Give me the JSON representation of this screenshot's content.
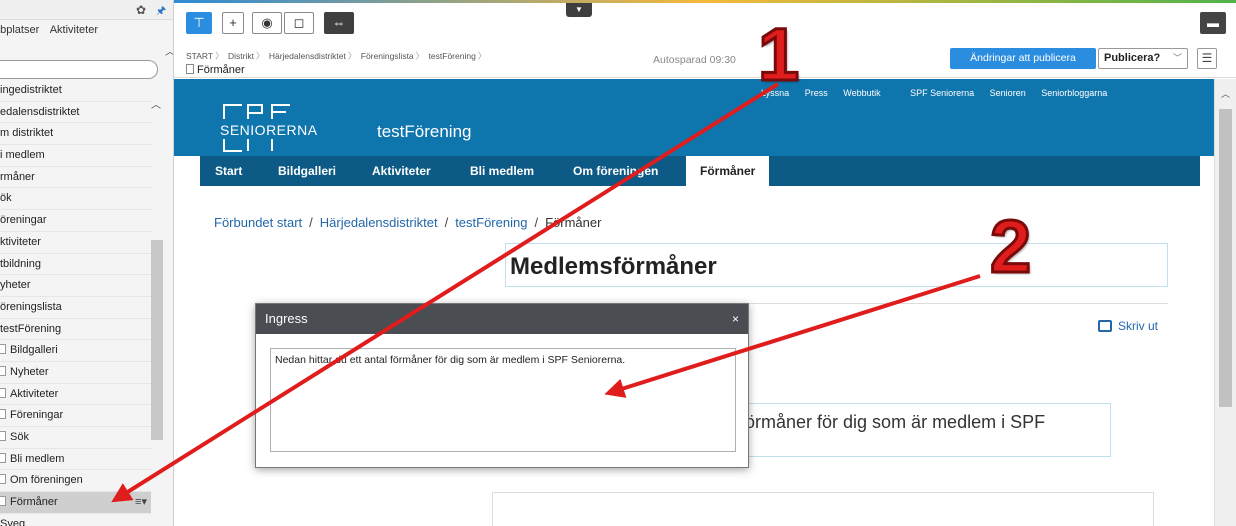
{
  "left_panel": {
    "tabs": [
      "obplatser",
      "Aktiviteter"
    ],
    "tree": [
      {
        "label": "ingedistriktet",
        "doc": false
      },
      {
        "label": "edalensdistriktet",
        "doc": false
      },
      {
        "label": "m distriktet",
        "doc": false
      },
      {
        "label": "i medlem",
        "doc": false
      },
      {
        "label": "rmåner",
        "doc": false
      },
      {
        "label": "ök",
        "doc": false
      },
      {
        "label": "öreningar",
        "doc": false
      },
      {
        "label": "ktiviteter",
        "doc": false
      },
      {
        "label": "tbildning",
        "doc": false
      },
      {
        "label": "yheter",
        "doc": false
      },
      {
        "label": "öreningslista",
        "doc": false
      },
      {
        "label": "testFörening",
        "doc": false
      },
      {
        "label": "Bildgalleri",
        "doc": true
      },
      {
        "label": "Nyheter",
        "doc": true
      },
      {
        "label": "Aktiviteter",
        "doc": true
      },
      {
        "label": "Föreningar",
        "doc": true
      },
      {
        "label": "Sök",
        "doc": true
      },
      {
        "label": "Bli medlem",
        "doc": true
      },
      {
        "label": "Om föreningen",
        "doc": true
      },
      {
        "label": "Förmåner",
        "doc": true,
        "selected": true
      },
      {
        "label": "Sveg",
        "doc": false
      }
    ]
  },
  "toolbar": {
    "buttons": [
      "tree-view",
      "add",
      "preview",
      "compare",
      "split"
    ]
  },
  "breadcrumb": {
    "path": [
      "START",
      "Distrikt",
      "Härjedalensdistriktet",
      "Föreningslista",
      "testFörening"
    ],
    "page": "Förmåner",
    "autosave": "Autosparad 09:30",
    "changes_label": "Ändringar att publicera",
    "publish_label": "Publicera?"
  },
  "site": {
    "toplinks": [
      "Lyssna",
      "Press",
      "Webbutik",
      "SPF Seniorerna",
      "Senioren",
      "Seniorbloggarna"
    ],
    "logo_text": "SENIORERNA",
    "org_name": "testFörening",
    "nav": [
      "Start",
      "Bildgalleri",
      "Aktiviteter",
      "Bli medlem",
      "Om föreningen",
      "Förmåner"
    ],
    "crumb": [
      "Förbundet start",
      "Härjedalensdistriktet",
      "testFörening",
      "Förmåner"
    ],
    "title": "Medlemsförmåner",
    "print_label": "Skriv ut",
    "ingress_visible": "förmåner för dig som är medlem i SPF"
  },
  "dialog": {
    "title": "Ingress",
    "close": "×",
    "value": "Nedan hittar du ett antal förmåner för dig som är medlem i SPF Seniorerna."
  },
  "annotations": {
    "label_1": "1",
    "label_2": "2",
    "color": "#e01d1d"
  }
}
